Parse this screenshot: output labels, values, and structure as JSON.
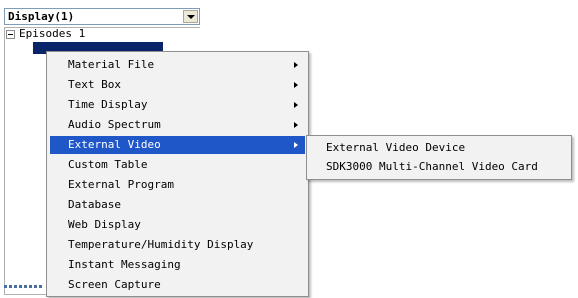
{
  "display_selector": {
    "value": "Display(1)"
  },
  "tree": {
    "root_label": "Episodes 1"
  },
  "context_menu": {
    "items": [
      {
        "label": "Material File",
        "has_submenu": true
      },
      {
        "label": "Text Box",
        "has_submenu": true
      },
      {
        "label": "Time Display",
        "has_submenu": true
      },
      {
        "label": "Audio Spectrum",
        "has_submenu": true
      },
      {
        "label": "External Video",
        "has_submenu": true,
        "highlighted": true
      },
      {
        "label": "Custom Table",
        "has_submenu": false
      },
      {
        "label": "External Program",
        "has_submenu": false
      },
      {
        "label": "Database",
        "has_submenu": false
      },
      {
        "label": "Web Display",
        "has_submenu": false
      },
      {
        "label": "Temperature/Humidity Display",
        "has_submenu": false
      },
      {
        "label": "Instant Messaging",
        "has_submenu": false
      },
      {
        "label": "Screen Capture",
        "has_submenu": false
      }
    ]
  },
  "submenu": {
    "items": [
      {
        "label": "External Video Device"
      },
      {
        "label": "SDK3000 Multi-Channel Video Card"
      }
    ]
  },
  "colors": {
    "highlight": "#1f57c8",
    "menu_background": "#f2f2f2",
    "tree_selection": "#0a246a"
  }
}
